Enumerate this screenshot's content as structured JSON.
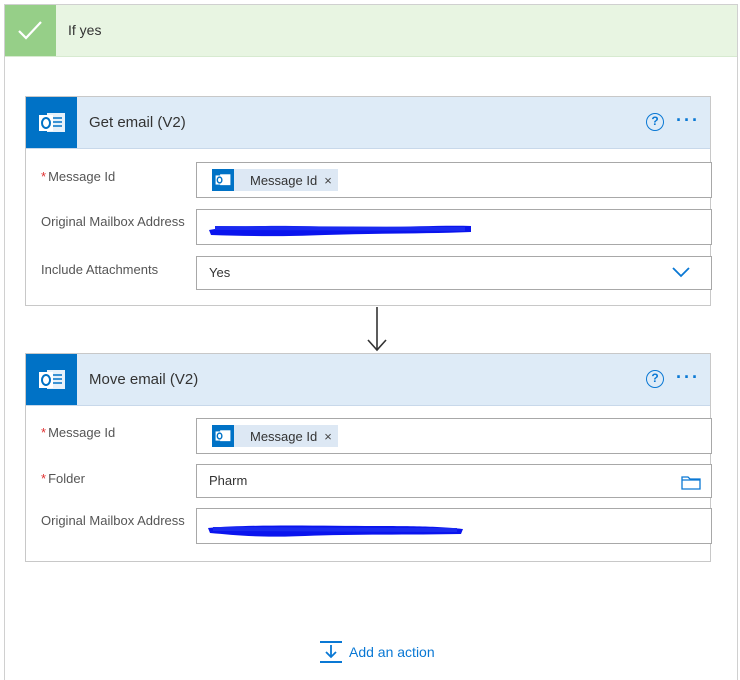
{
  "condition": {
    "title": "If yes"
  },
  "actions": [
    {
      "title": "Get email (V2)",
      "fields": {
        "message_id": {
          "label": "Message Id",
          "token": "Message Id"
        },
        "mailbox": {
          "label": "Original Mailbox Address"
        },
        "attachments": {
          "label": "Include Attachments",
          "value": "Yes"
        }
      }
    },
    {
      "title": "Move email (V2)",
      "fields": {
        "message_id": {
          "label": "Message Id",
          "token": "Message Id"
        },
        "folder": {
          "label": "Folder",
          "value": "Pharm"
        },
        "mailbox": {
          "label": "Original Mailbox Address"
        }
      }
    }
  ],
  "add_action_label": "Add an action",
  "icons": {
    "help": "?",
    "more": "···",
    "token_close": "×",
    "required": "*"
  },
  "colors": {
    "accent": "#0a78d4",
    "outlook": "#0072c6",
    "success": "#96cf88",
    "redaction": "#0a14ee"
  }
}
